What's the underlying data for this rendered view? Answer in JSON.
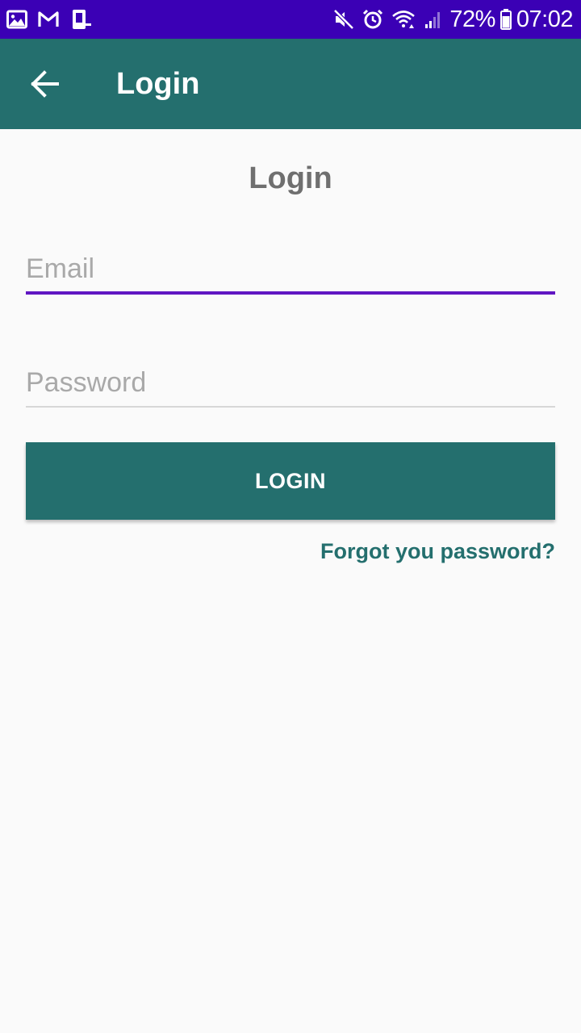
{
  "status_bar": {
    "background": "#3b00b5",
    "left_icons": [
      "gallery-icon",
      "gmail-icon",
      "device-icon"
    ],
    "right_icons": [
      "mute-icon",
      "alarm-icon",
      "wifi-icon",
      "signal-icon"
    ],
    "battery_percent": "72%",
    "battery_icon": "battery-icon",
    "time": "07:02"
  },
  "app_bar": {
    "background": "#246f6e",
    "back_icon": "arrow-back-icon",
    "title": "Login"
  },
  "form": {
    "heading": "Login",
    "email": {
      "value": "",
      "placeholder": "Email",
      "underline_color": "#6016c2"
    },
    "password": {
      "value": "",
      "placeholder": "Password",
      "underline_color": "#d7d7d7"
    },
    "login_button_label": "LOGIN",
    "forgot_link": "Forgot you password?"
  },
  "colors": {
    "accent": "#246f6e",
    "status_bar": "#3b00b5",
    "background": "#fafafa"
  }
}
